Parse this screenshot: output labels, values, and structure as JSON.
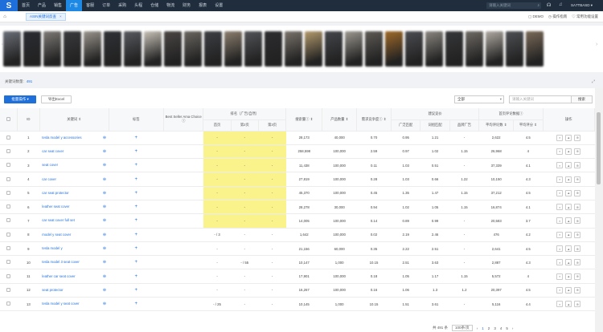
{
  "topbar": {
    "logo": "S",
    "nav": [
      "首页",
      "产品",
      "销售",
      "广告",
      "客服",
      "订单",
      "采购",
      "头程",
      "仓储",
      "物流",
      "财务",
      "报表",
      "设置"
    ],
    "active_index": 3,
    "search_placeholder": "请输入关键词",
    "user": "SA7TBASD"
  },
  "tabbar": {
    "tab_label": "ASIN关键词反查",
    "links": [
      "DEMO",
      "操作指南",
      "常用功能设置"
    ]
  },
  "thumbs": {
    "colors": [
      "#6b6f78",
      "#2a2c33",
      "#7e7a76",
      "#3a3a3e",
      "#9a948c",
      "#2f3136",
      "#585a60",
      "#c8c2b8",
      "#4a4644",
      "#6a6660",
      "#3d3f44",
      "#8c7f6e",
      "#525458",
      "#2c2c30",
      "#7a736b",
      "#b39a6c",
      "#44464b",
      "#9c9890",
      "#5e5a55",
      "#a06a28",
      "#4c4d52",
      "#8a8680",
      "#363739",
      "#6f6a64",
      "#b0aaa2",
      "#4e5054",
      "#7b6a58"
    ]
  },
  "summary": {
    "label": "关键词数量:",
    "count": "491"
  },
  "toolbar": {
    "batch_button": "批量操作 ▾",
    "export_button": "导出Excel",
    "select_value": "全部",
    "keyword_placeholder": "请输入关键词",
    "search_button": "搜索"
  },
  "table": {
    "headers": {
      "id": "ID",
      "keyword": "关键词 ⇕",
      "tag": "标签",
      "bestseller": "Best Seller Ama Choice ⓘ",
      "rank_group": "排名（广告/自然）",
      "rank_cols": [
        "首页",
        "第2页",
        "第3页"
      ],
      "search_volume": "搜索量ⓘ ⇕",
      "product_count": "产品数量 ⇕",
      "supply_demand": "需求竞争度ⓘ ⇕",
      "bid_group": "建议竞价",
      "bid_cols": [
        "广泛匹配",
        "词组匹配",
        "品牌广告"
      ],
      "review_group": "首页评论数据ⓘ",
      "review_cols": [
        "平均评论数 ⇕",
        "平均评分 ⇕"
      ],
      "actions": "操作"
    },
    "rows": [
      {
        "id": "1",
        "keyword": "tesla model y accessories",
        "r1": "-",
        "r2": "-",
        "r3": "-",
        "sv": "28,173",
        "pc": "40,000",
        "sd": "0.70",
        "b1": "0.95",
        "b2": "1.21",
        "b3": "-",
        "rc": "2,622",
        "rs": "4.5",
        "hl": true
      },
      {
        "id": "2",
        "keyword": "car seat cover",
        "r1": "-",
        "r2": "-",
        "r3": "-",
        "sv": "258,598",
        "pc": "100,000",
        "sd": "2.59",
        "b1": "0.97",
        "b2": "1.02",
        "b3": "1.15",
        "rc": "26,968",
        "rs": "4",
        "hl": true
      },
      {
        "id": "3",
        "keyword": "seat cover",
        "r1": "-",
        "r2": "-",
        "r3": "-",
        "sv": "11,438",
        "pc": "100,000",
        "sd": "0.11",
        "b1": "1.03",
        "b2": "0.51",
        "b3": "-",
        "rc": "37,339",
        "rs": "4.1",
        "hl": true
      },
      {
        "id": "4",
        "keyword": "car cover",
        "r1": "-",
        "r2": "-",
        "r3": "-",
        "sv": "27,819",
        "pc": "100,000",
        "sd": "0.28",
        "b1": "1.03",
        "b2": "0.66",
        "b3": "1.22",
        "rc": "10,150",
        "rs": "4.3",
        "hl": true
      },
      {
        "id": "5",
        "keyword": "car seat protector",
        "r1": "-",
        "r2": "-",
        "r3": "-",
        "sv": "45,370",
        "pc": "100,000",
        "sd": "0.45",
        "b1": "1.35",
        "b2": "1.47",
        "b3": "1.15",
        "rc": "37,212",
        "rs": "4.5",
        "hl": true
      },
      {
        "id": "6",
        "keyword": "leather seat cover",
        "r1": "-",
        "r2": "-",
        "r3": "-",
        "sv": "28,278",
        "pc": "30,000",
        "sd": "0.94",
        "b1": "1.02",
        "b2": "1.05",
        "b3": "1.15",
        "rc": "16,874",
        "rs": "4.1",
        "hl": true
      },
      {
        "id": "7",
        "keyword": "car seat cover full set",
        "r1": "-",
        "r2": "-",
        "r3": "-",
        "sv": "14,005",
        "pc": "100,000",
        "sd": "0.14",
        "b1": "0.89",
        "b2": "0.99",
        "b3": "-",
        "rc": "20,583",
        "rs": "3.7",
        "hl": true
      },
      {
        "id": "8",
        "keyword": "model y seat cover",
        "r1": "- / 3",
        "r2": "-",
        "r3": "-",
        "sv": "1,642",
        "pc": "100,000",
        "sd": "0.02",
        "b1": "2.19",
        "b2": "2.46",
        "b3": "-",
        "rc": "476",
        "rs": "4.2",
        "hl": false
      },
      {
        "id": "9",
        "keyword": "tesla model y",
        "r1": "-",
        "r2": "-",
        "r3": "-",
        "sv": "21,156",
        "pc": "60,000",
        "sd": "0.35",
        "b1": "2.22",
        "b2": "2.51",
        "b3": "-",
        "rc": "2,641",
        "rs": "4.5",
        "hl": false
      },
      {
        "id": "10",
        "keyword": "tesla model 3 seat cover",
        "r1": "-",
        "r2": "- / 55",
        "r3": "-",
        "sv": "10,147",
        "pc": "1,000",
        "sd": "10.15",
        "b1": "2.51",
        "b2": "3.63",
        "b3": "-",
        "rc": "2,887",
        "rs": "4.3",
        "hl": false
      },
      {
        "id": "11",
        "keyword": "leather car seat cover",
        "r1": "-",
        "r2": "-",
        "r3": "-",
        "sv": "17,901",
        "pc": "100,000",
        "sd": "0.18",
        "b1": "1.05",
        "b2": "1.17",
        "b3": "1.15",
        "rc": "5,572",
        "rs": "4",
        "hl": false
      },
      {
        "id": "12",
        "keyword": "seat protector",
        "r1": "-",
        "r2": "-",
        "r3": "-",
        "sv": "16,267",
        "pc": "100,000",
        "sd": "0.16",
        "b1": "1.06",
        "b2": "1.3",
        "b3": "1.2",
        "rc": "20,397",
        "rs": "4.5",
        "hl": false
      },
      {
        "id": "13",
        "keyword": "tesla model y seat cover",
        "r1": "- / 25",
        "r2": "-",
        "r3": "-",
        "sv": "10,145",
        "pc": "1,000",
        "sd": "10.15",
        "b1": "1.51",
        "b2": "3.61",
        "b3": "-",
        "rc": "5,116",
        "rs": "4.4",
        "hl": false
      }
    ]
  },
  "pager": {
    "total": "共 491 条",
    "page_size": "100条/页",
    "pages": [
      "1",
      "2",
      "3",
      "4",
      "5"
    ],
    "active": "1",
    "prev": "‹",
    "next": "›"
  }
}
